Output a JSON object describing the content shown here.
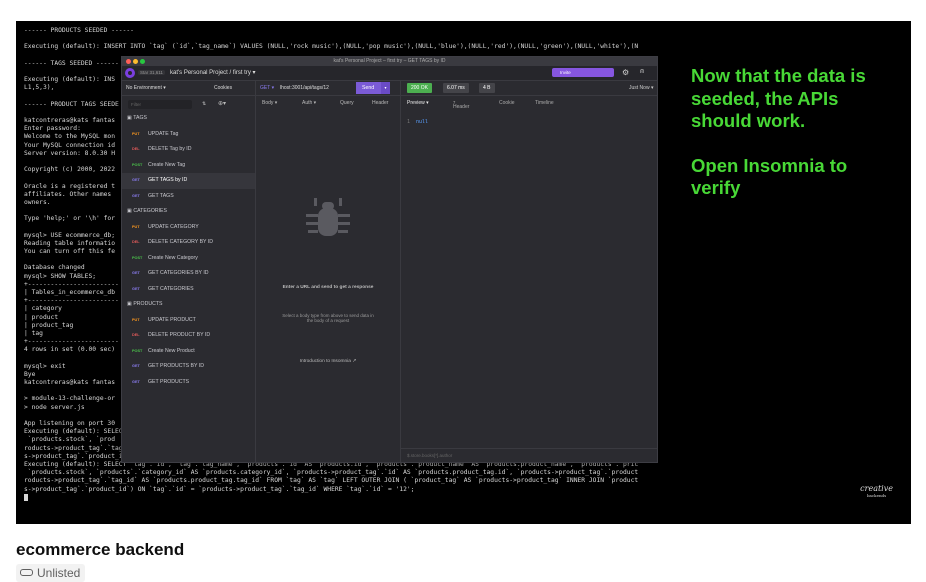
{
  "terminal": {
    "lines": [
      "------ PRODUCTS SEEDED ------",
      "",
      "Executing (default): INSERT INTO `tag` (`id`,`tag_name`) VALUES (NULL,'rock music'),(NULL,'pop music'),(NULL,'blue'),(NULL,'red'),(NULL,'green'),(NULL,'white'),(N",
      "",
      "------ TAGS SEEDED ------",
      "",
      "Executing (default): INS",
      "L1,5,3),",
      "",
      "------ PRODUCT TAGS SEEDE",
      "",
      "katcontreras@kats fantas",
      "Enter password:",
      "Welcome to the MySQL mon",
      "Your MySQL connection id",
      "Server version: 8.0.30 H",
      "",
      "Copyright (c) 2000, 2022",
      "",
      "Oracle is a registered t",
      "affiliates. Other names",
      "owners.",
      "",
      "Type 'help;' or '\\h' for",
      "",
      "mysql> USE ecommerce_db;",
      "Reading table informatio",
      "You can turn off this fe",
      "",
      "Database changed",
      "mysql> SHOW TABLES;",
      "+------------------------",
      "| Tables_in_ecommerce_db",
      "+------------------------",
      "| category",
      "| product",
      "| product_tag",
      "| tag",
      "+------------------------",
      "4 rows in set (0.00 sec)",
      "",
      "mysql> exit",
      "Bye",
      "katcontreras@kats fantas",
      "",
      "> module-13-challenge-or",
      "> node server.js",
      "",
      "App listening on port 30",
      "Executing (default): SELECT                                                                                                          pric",
      " `products.stock`, `prod                                                                                                             duct",
      "roducts->product_tag`.`tag_id` AS `products.product_tag.tag_id` FROM `tag` AS `tag` LEFT OUTER JOIN ( `product_tag` AS `products->product_tag` INNER JOIN `product",
      "s->product_tag`.`product_id`) ON `tag`.`id` = `products->product_tag`.`tag_id`;",
      "Executing (default): SELECT `tag`.`id`, `tag`.`tag_name`, `products`.`id` AS `products.id`, `products`.`product_name` AS `products.product_name`, `products`.`pric",
      " `products.stock`, `products`.`category_id` AS `products.category_id`, `products->product_tag`.`id` AS `products.product_tag.id`, `products->product_tag`.`product",
      "roducts->product_tag`.`tag_id` AS `products.product_tag.tag_id` FROM `tag` AS `tag` LEFT OUTER JOIN ( `product_tag` AS `products->product_tag` INNER JOIN `product",
      "s->product_tag`.`product_id`) ON `tag`.`id` = `products->product_tag`.`tag_id` WHERE `tag`.`id` = '12';"
    ]
  },
  "insomnia": {
    "window_title": "kat's Personal Project – first try – GET TAGS by ID",
    "stars": "Star 31,611",
    "breadcrumb": "kat's Personal Project / first try ▾",
    "invite_label": "Invite",
    "environment": "No Environment ▾",
    "cookies": "Cookies",
    "filter_placeholder": "Filter",
    "sidebar": [
      {
        "type": "folder",
        "label": "TAGS"
      },
      {
        "type": "request",
        "method": "PUT",
        "label": "UPDATE Tag"
      },
      {
        "type": "request",
        "method": "DEL",
        "label": "DELETE Tag by ID"
      },
      {
        "type": "request",
        "method": "POST",
        "label": "Create New Tag"
      },
      {
        "type": "request",
        "method": "GET",
        "label": "GET TAGS by ID",
        "active": true
      },
      {
        "type": "request",
        "method": "GET",
        "label": "GET TAGS"
      },
      {
        "type": "folder",
        "label": "CATEGORIES"
      },
      {
        "type": "request",
        "method": "PUT",
        "label": "UPDATE CATEGORY"
      },
      {
        "type": "request",
        "method": "DEL",
        "label": "DELETE CATEGORY BY ID"
      },
      {
        "type": "request",
        "method": "POST",
        "label": "Create New Category"
      },
      {
        "type": "request",
        "method": "GET",
        "label": "GET CATEGORIES BY ID"
      },
      {
        "type": "request",
        "method": "GET",
        "label": "GET CATEGORIES"
      },
      {
        "type": "folder",
        "label": "PRODUCTS"
      },
      {
        "type": "request",
        "method": "PUT",
        "label": "UPDATE PRODUCT"
      },
      {
        "type": "request",
        "method": "DEL",
        "label": "DELETE PRODUCT BY ID"
      },
      {
        "type": "request",
        "method": "POST",
        "label": "Create New Product"
      },
      {
        "type": "request",
        "method": "GET",
        "label": "GET PRODUCTS BY ID"
      },
      {
        "type": "request",
        "method": "GET",
        "label": "GET PRODUCTS"
      }
    ],
    "request": {
      "method": "GET ▾",
      "url": "lhost:3001/api/tags/12",
      "send_label": "Send",
      "tabs": [
        "Body ▾",
        "Auth ▾",
        "Query",
        "Header"
      ],
      "empty_title": "Enter a URL and send to get a response",
      "empty_sub": "Select a body type from above to send data in the body of a request",
      "intro_link": "Introduction to Insomnia"
    },
    "response": {
      "status": "200 OK",
      "time": "6.07 ms",
      "size": "4 B",
      "timestamp": "Just Now ▾",
      "tabs": [
        "Preview ▾",
        "Header",
        "Cookie",
        "Timeline"
      ],
      "header_count": "7",
      "line_number": "1",
      "body": "null",
      "filter_placeholder": "$.store.books[*].author"
    }
  },
  "overlay": {
    "line1": "Now that the data is seeded, the APIs should work.",
    "line2": "Open Insomnia to verify"
  },
  "brand": {
    "name": "creative",
    "sub": "backends"
  },
  "video": {
    "title": "ecommerce backend",
    "visibility": "Unlisted"
  },
  "colors": {
    "overlay_text": "#48d836",
    "send": "#7b5bd6",
    "status_ok": "#4caf50",
    "method_get": "#8a7cf0",
    "method_put": "#ff9a1f",
    "method_delete": "#e55b5b",
    "method_post": "#4bc34b"
  }
}
